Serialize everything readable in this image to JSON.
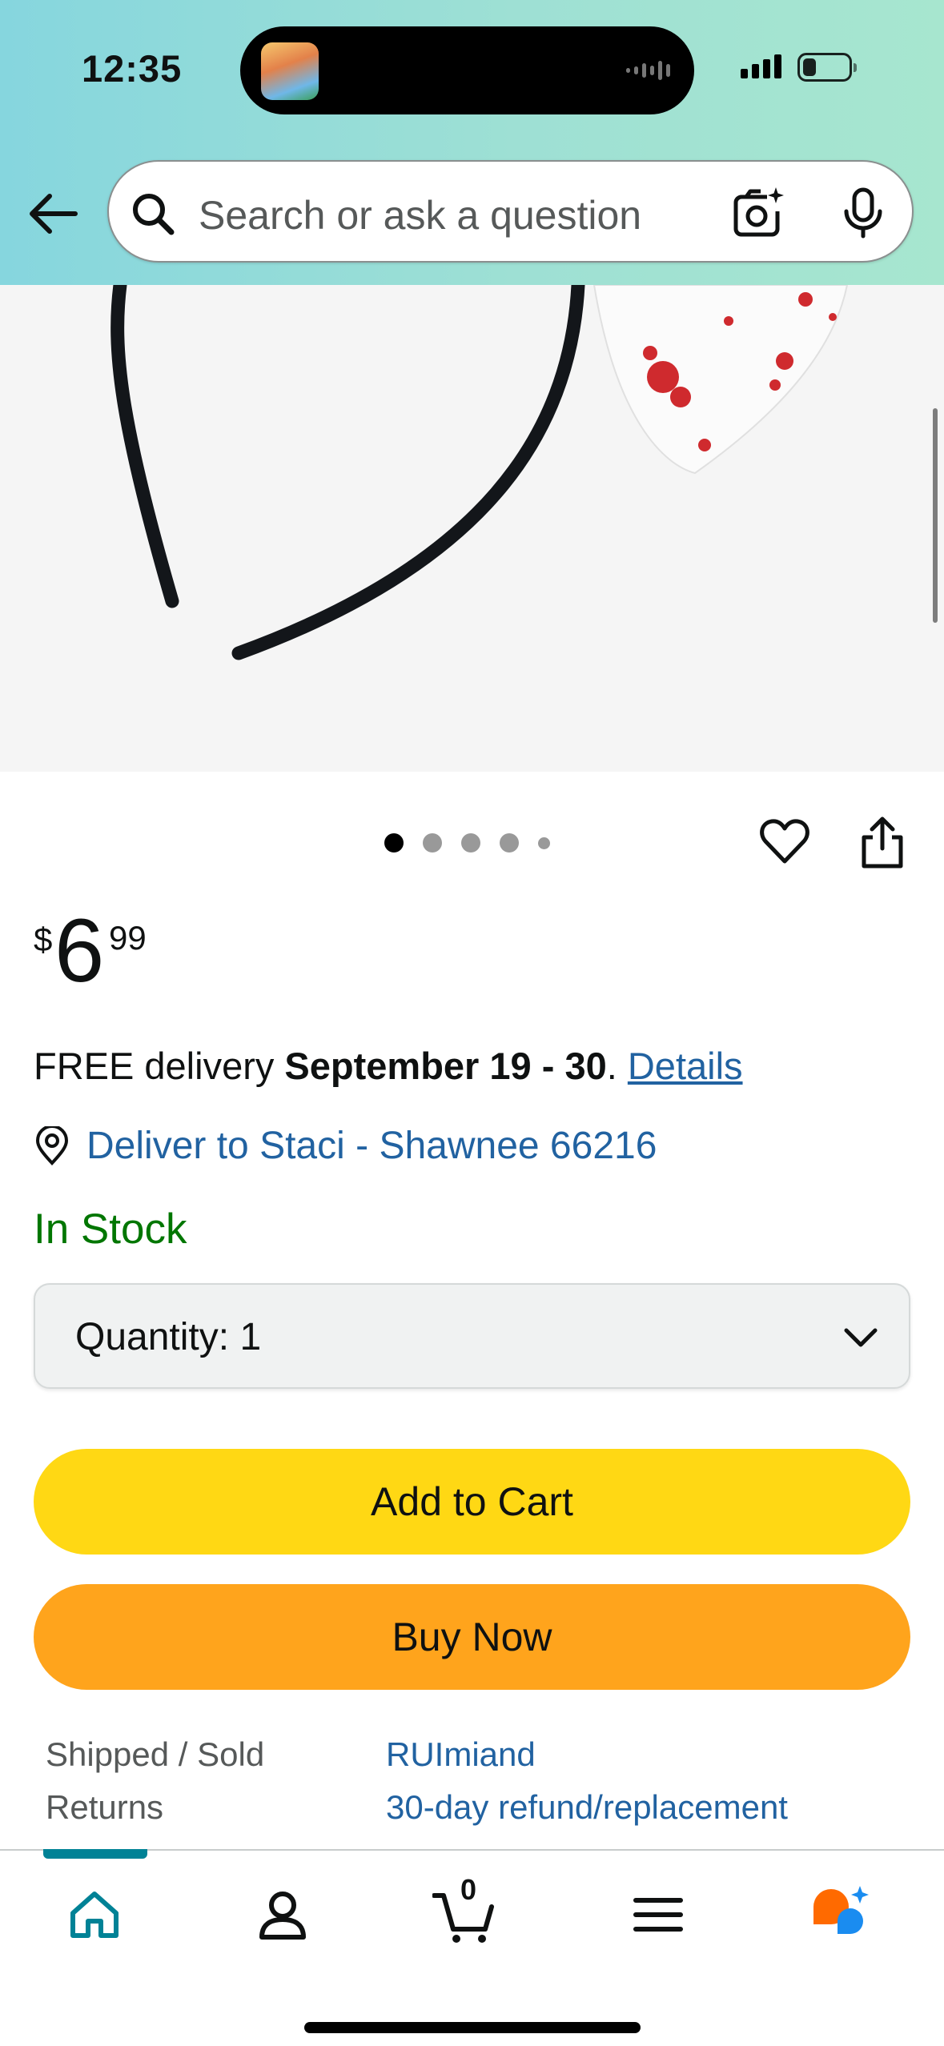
{
  "status_bar": {
    "time": "12:35"
  },
  "search": {
    "placeholder": "Search or ask a question"
  },
  "product": {
    "price_symbol": "$",
    "price_whole": "6",
    "price_fraction": "99",
    "image_dots_count": 5,
    "image_dots_active": 1
  },
  "delivery": {
    "prefix": "FREE delivery ",
    "dates": "September 19 - 30",
    "suffix": ". ",
    "details_link": "Details"
  },
  "deliver_to": "Deliver to Staci - Shawnee 66216",
  "stock_status": "In Stock",
  "quantity": {
    "label": "Quantity:",
    "value": "1"
  },
  "buttons": {
    "add_to_cart": "Add to Cart",
    "buy_now": "Buy Now"
  },
  "info_rows": [
    {
      "key": "Shipped / Sold",
      "value": "RUImiand"
    },
    {
      "key": "Returns",
      "value": "30-day refund/replacement"
    }
  ],
  "bottom_nav": {
    "cart_count": "0"
  },
  "colors": {
    "header_gradient_start": "#86d6de",
    "header_gradient_end": "#a7e6cf",
    "link": "#2162a1",
    "in_stock": "#007600",
    "add_to_cart": "#ffd814",
    "buy_now": "#ffa41c",
    "nav_active": "#008296"
  }
}
